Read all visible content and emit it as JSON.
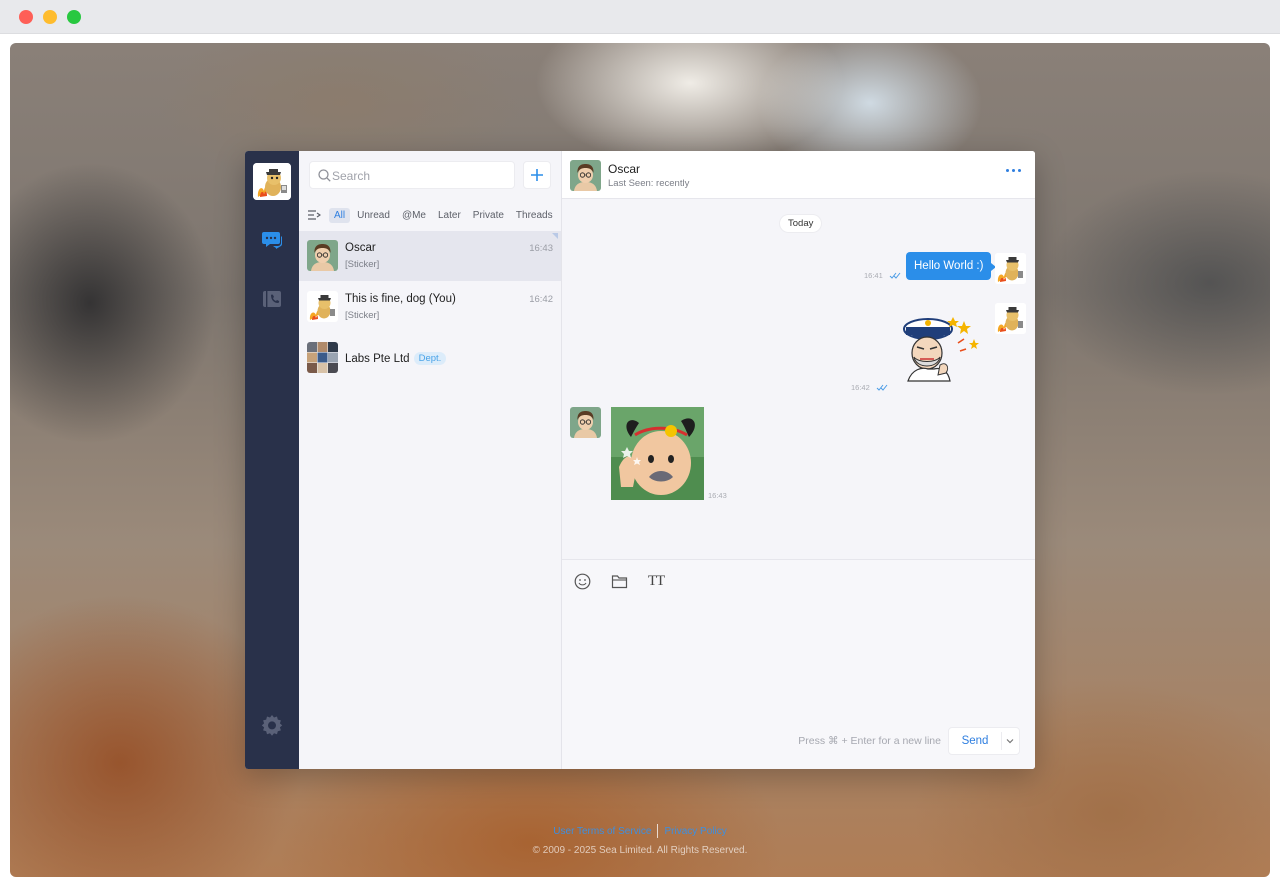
{
  "window": {
    "controls": [
      "close",
      "minimize",
      "zoom"
    ]
  },
  "sidebar": {
    "icons": [
      "dog-avatar",
      "chat-bubbles-icon",
      "contacts-book-icon",
      "gear-icon"
    ],
    "accent": "#2b8ee9"
  },
  "search": {
    "placeholder": "Search"
  },
  "filters": {
    "active": "All",
    "items": [
      "All",
      "Unread",
      "@Me",
      "Later",
      "Private",
      "Threads"
    ]
  },
  "conversations": [
    {
      "name": "Oscar",
      "preview": "[Sticker]",
      "time": "16:43",
      "selected": true
    },
    {
      "name": "This is fine, dog (You)",
      "preview": "[Sticker]",
      "time": "16:42",
      "selected": false
    },
    {
      "name": "Labs Pte Ltd",
      "badge": "Dept.",
      "selected": false
    }
  ],
  "chat": {
    "title": "Oscar",
    "status": "Last Seen: recently",
    "date_separator": "Today",
    "messages": [
      {
        "from": "me",
        "type": "text",
        "text": "Hello World :)",
        "time": "16:41",
        "read": true
      },
      {
        "from": "me",
        "type": "sticker",
        "sticker": "sailor-captain-sticker",
        "time": "16:42",
        "read": true
      },
      {
        "from": "Oscar",
        "type": "sticker",
        "sticker": "baby-face-sticker",
        "time": "16:43"
      }
    ]
  },
  "composer": {
    "tools": [
      "emoji-icon",
      "folder-icon",
      "text-format-icon"
    ],
    "text_tool_glyph": "TT",
    "hint": "Press ⌘ + Enter for a new line",
    "send_label": "Send"
  },
  "footer": {
    "terms": "User Terms of Service",
    "privacy": "Privacy Policy",
    "copyright": "© 2009 - 2025 Sea Limited. All Rights Reserved."
  }
}
